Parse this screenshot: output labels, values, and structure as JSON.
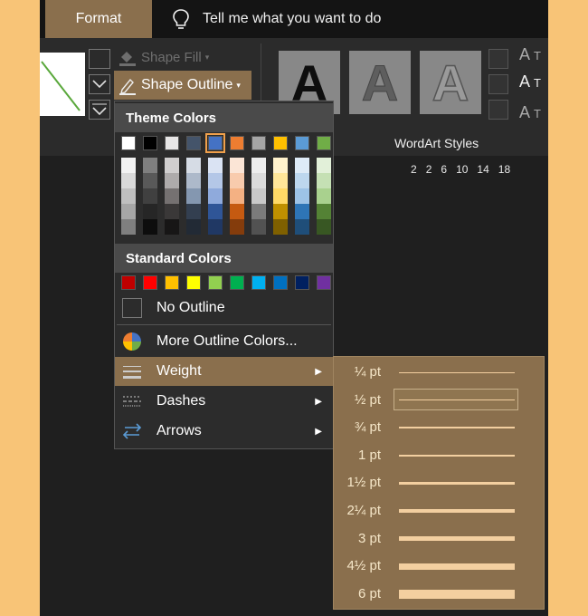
{
  "ribbon": {
    "tab_format": "Format",
    "tell_me": "Tell me what you want to do",
    "shape_fill": "Shape Fill",
    "shape_outline": "Shape Outline",
    "wordart_styles": "WordArt Styles",
    "wordart_letter": "A",
    "side_letter": "A",
    "side_t": "T",
    "ruler": [
      "2",
      "2",
      "6",
      "10",
      "14",
      "18"
    ]
  },
  "dropdown": {
    "theme_header": "Theme Colors",
    "standard_header": "Standard Colors",
    "theme_colors": [
      "#ffffff",
      "#000000",
      "#e7e6e6",
      "#44546a",
      "#4472c4",
      "#ed7d31",
      "#a5a5a5",
      "#ffc000",
      "#5b9bd5",
      "#70ad47"
    ],
    "theme_shades": [
      [
        "#f2f2f2",
        "#d9d9d9",
        "#bfbfbf",
        "#a6a6a6",
        "#7f7f7f"
      ],
      [
        "#7f7f7f",
        "#595959",
        "#404040",
        "#262626",
        "#0d0d0d"
      ],
      [
        "#d0cece",
        "#aeabab",
        "#757171",
        "#3a3838",
        "#171616"
      ],
      [
        "#d6dce5",
        "#adb9ca",
        "#8497b0",
        "#333f50",
        "#222a35"
      ],
      [
        "#dae3f3",
        "#b4c7e7",
        "#8faadc",
        "#2f5597",
        "#203864"
      ],
      [
        "#fbe5d6",
        "#f8cbad",
        "#f4b183",
        "#c55a11",
        "#843c0c"
      ],
      [
        "#ededed",
        "#dbdbdb",
        "#c9c9c9",
        "#7b7b7b",
        "#525252"
      ],
      [
        "#fff2cc",
        "#ffe699",
        "#ffd966",
        "#bf9000",
        "#7f6000"
      ],
      [
        "#deebf7",
        "#bdd7ee",
        "#9dc3e6",
        "#2e75b6",
        "#1f4e79"
      ],
      [
        "#e2f0d9",
        "#c5e0b4",
        "#a9d18e",
        "#548235",
        "#385723"
      ]
    ],
    "standard_colors": [
      "#c00000",
      "#ff0000",
      "#ffc000",
      "#ffff00",
      "#92d050",
      "#00b050",
      "#00b0f0",
      "#0070c0",
      "#002060",
      "#7030a0"
    ],
    "no_outline": "No Outline",
    "more_colors": "More Outline Colors...",
    "weight": "Weight",
    "dashes": "Dashes",
    "arrows": "Arrows"
  },
  "weights": [
    "¼ pt",
    "½ pt",
    "¾ pt",
    "1 pt",
    "1½ pt",
    "2¼ pt",
    "3 pt",
    "4½ pt",
    "6 pt"
  ]
}
